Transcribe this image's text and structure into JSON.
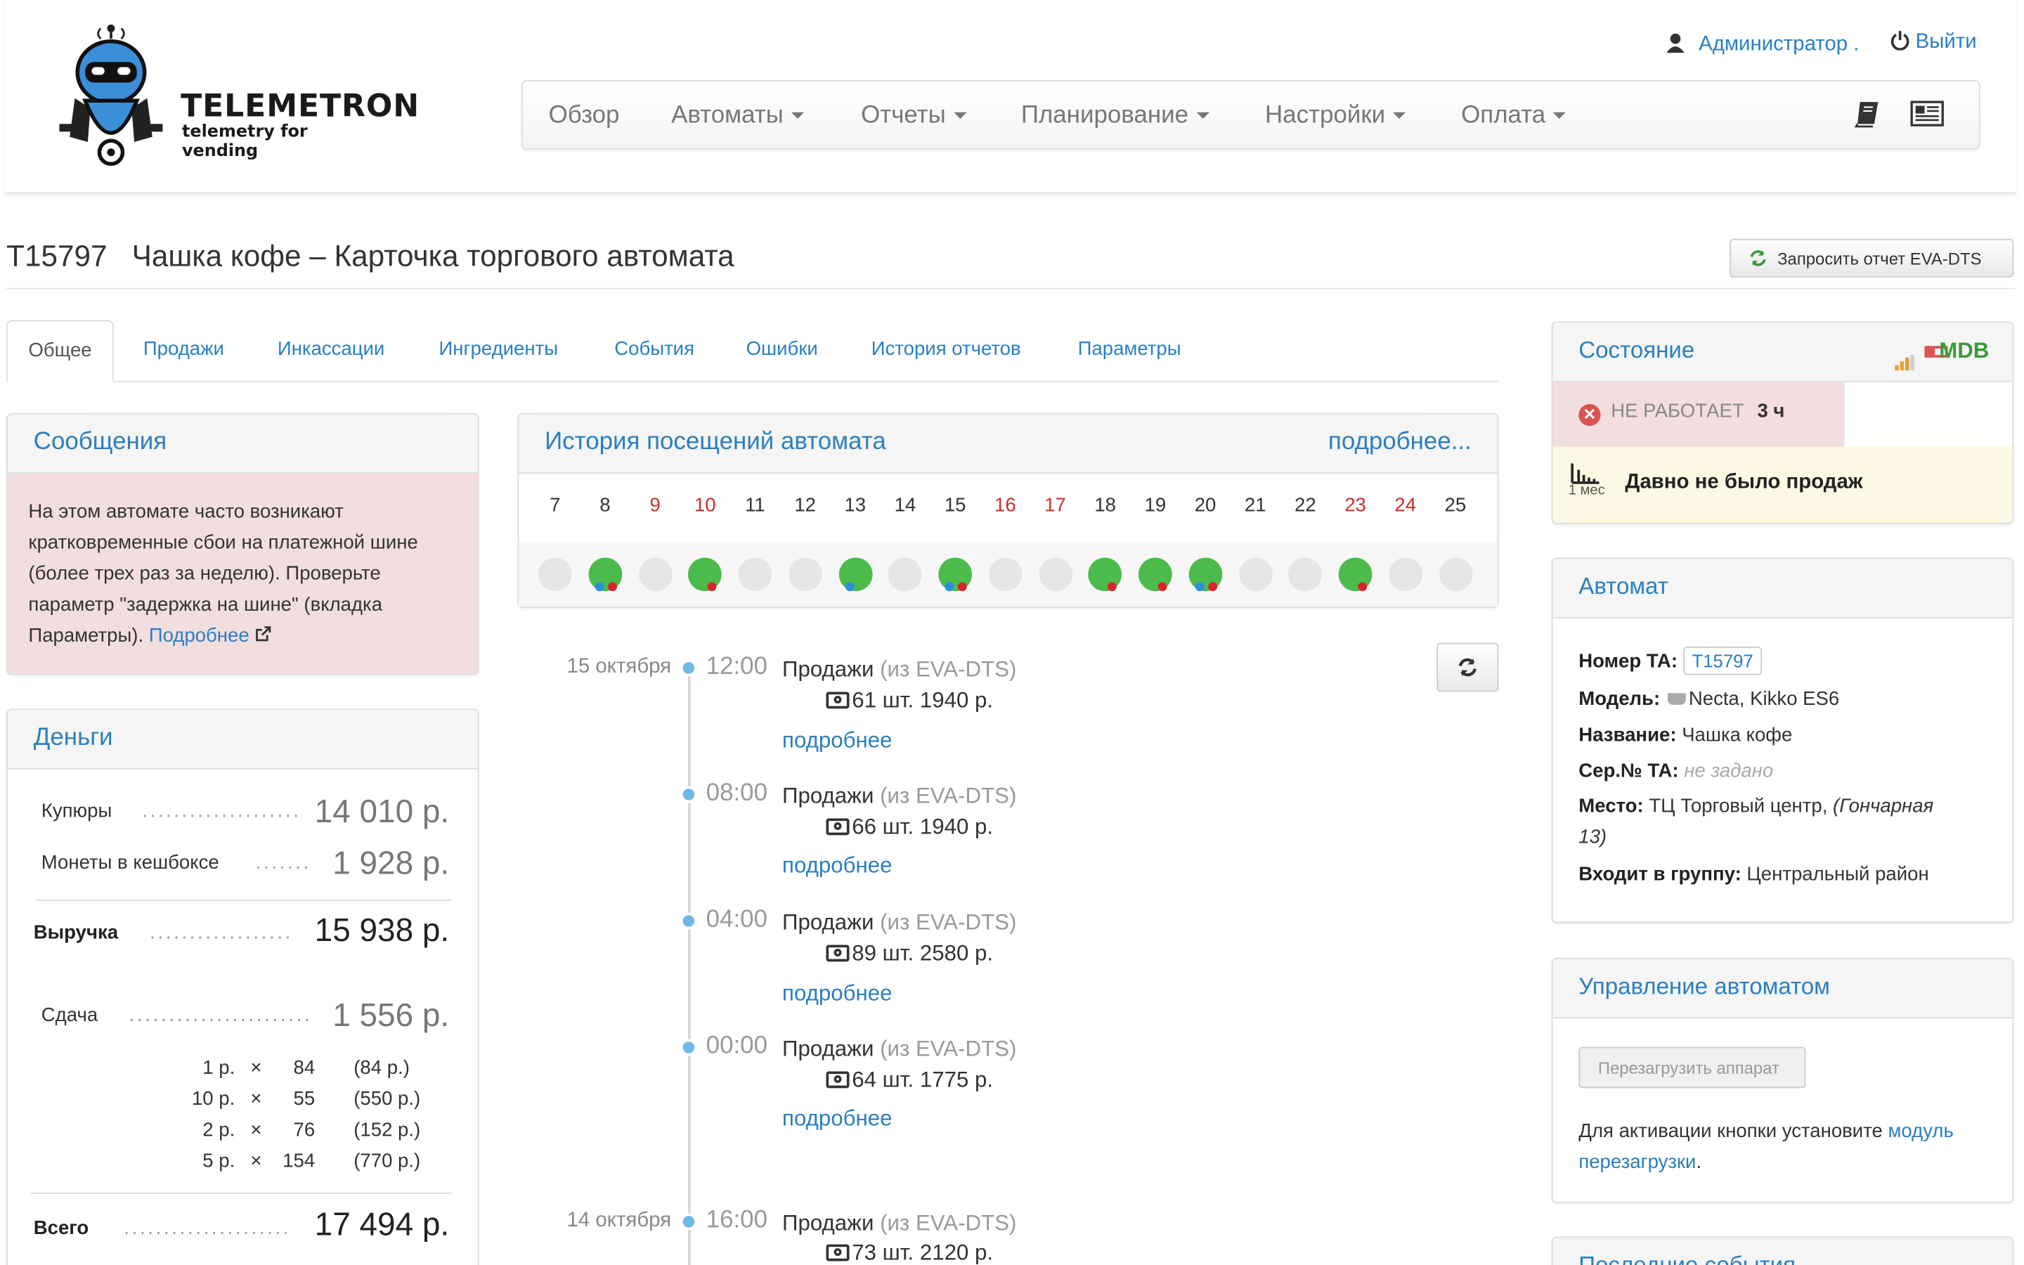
{
  "header": {
    "logo_title": "TELEMETRON",
    "logo_subtitle": "telemetry for vending",
    "user_label": "Администратор .",
    "logout_label": "Выйти",
    "nav": [
      {
        "label": "Обзор",
        "has_caret": false
      },
      {
        "label": "Автоматы",
        "has_caret": true
      },
      {
        "label": "Отчеты",
        "has_caret": true
      },
      {
        "label": "Планирование",
        "has_caret": true
      },
      {
        "label": "Настройки",
        "has_caret": true
      },
      {
        "label": "Оплата",
        "has_caret": true
      }
    ],
    "icons": [
      "book-icon",
      "newspaper-icon"
    ]
  },
  "page": {
    "title": "Т15797   Чашка кофе – Карточка торгового автомата",
    "eva_button": "Запросить отчет EVA-DTS"
  },
  "tabs": [
    "Общее",
    "Продажи",
    "Инкассации",
    "Ингредиенты",
    "События",
    "Ошибки",
    "История отчетов",
    "Параметры"
  ],
  "messages": {
    "title": "Сообщения",
    "text": "На этом автомате часто возникают кратковременные сбои на платежной шине (более трех раз за неделю). Проверьте параметр \"задержка на шине\" (вкладка Параметры).",
    "link": "Подробнее"
  },
  "money": {
    "title": "Деньги",
    "bills_label": "Купюры",
    "bills_value": "14 010 р.",
    "coins_label": "Монеты в кешбоксе",
    "coins_value": "1 928 р.",
    "revenue_label": "Выручка",
    "revenue_value": "15 938 р.",
    "change_label": "Сдача",
    "change_value": "1 556 р.",
    "coins": [
      {
        "nominal": "1 р.",
        "x": "×",
        "count": "84",
        "sum": "(84 р.)"
      },
      {
        "nominal": "10 р.",
        "x": "×",
        "count": "55",
        "sum": "(550 р.)"
      },
      {
        "nominal": "2 р.",
        "x": "×",
        "count": "76",
        "sum": "(152 р.)"
      },
      {
        "nominal": "5 р.",
        "x": "×",
        "count": "154",
        "sum": "(770 р.)"
      }
    ],
    "total_label": "Всего",
    "total_value": "17 494 р."
  },
  "history": {
    "title": "История посещений автомата",
    "more": "подробнее...",
    "days": [
      {
        "d": "7",
        "red": false,
        "visit": false,
        "blue": false,
        "redsub": false
      },
      {
        "d": "8",
        "red": false,
        "visit": true,
        "blue": true,
        "redsub": true
      },
      {
        "d": "9",
        "red": true,
        "visit": false,
        "blue": false,
        "redsub": false
      },
      {
        "d": "10",
        "red": true,
        "visit": true,
        "blue": false,
        "redsub": true
      },
      {
        "d": "11",
        "red": false,
        "visit": false,
        "blue": false,
        "redsub": false
      },
      {
        "d": "12",
        "red": false,
        "visit": false,
        "blue": false,
        "redsub": false
      },
      {
        "d": "13",
        "red": false,
        "visit": true,
        "blue": true,
        "redsub": false
      },
      {
        "d": "14",
        "red": false,
        "visit": false,
        "blue": false,
        "redsub": false
      },
      {
        "d": "15",
        "red": false,
        "visit": true,
        "blue": true,
        "redsub": true
      },
      {
        "d": "16",
        "red": true,
        "visit": false,
        "blue": false,
        "redsub": false
      },
      {
        "d": "17",
        "red": true,
        "visit": false,
        "blue": false,
        "redsub": false
      },
      {
        "d": "18",
        "red": false,
        "visit": true,
        "blue": false,
        "redsub": true
      },
      {
        "d": "19",
        "red": false,
        "visit": true,
        "blue": false,
        "redsub": true
      },
      {
        "d": "20",
        "red": false,
        "visit": true,
        "blue": true,
        "redsub": true
      },
      {
        "d": "21",
        "red": false,
        "visit": false,
        "blue": false,
        "redsub": false
      },
      {
        "d": "22",
        "red": false,
        "visit": false,
        "blue": false,
        "redsub": false
      },
      {
        "d": "23",
        "red": true,
        "visit": true,
        "blue": false,
        "redsub": true
      },
      {
        "d": "24",
        "red": true,
        "visit": false,
        "blue": false,
        "redsub": false
      },
      {
        "d": "25",
        "red": false,
        "visit": false,
        "blue": false,
        "redsub": false
      }
    ]
  },
  "timeline": [
    {
      "date": "15 октября",
      "time": "12:00",
      "title": "Продажи",
      "source": "(из EVA-DTS)",
      "summary": "61 шт. 1940 р.",
      "more": "подробнее"
    },
    {
      "date": "",
      "time": "08:00",
      "title": "Продажи",
      "source": "(из EVA-DTS)",
      "summary": "66 шт. 1940 р.",
      "more": "подробнее"
    },
    {
      "date": "",
      "time": "04:00",
      "title": "Продажи",
      "source": "(из EVA-DTS)",
      "summary": "89 шт. 2580 р.",
      "more": "подробнее"
    },
    {
      "date": "",
      "time": "00:00",
      "title": "Продажи",
      "source": "(из EVA-DTS)",
      "summary": "64 шт. 1775 р.",
      "more": "подробнее"
    },
    {
      "date": "14 октября",
      "time": "16:00",
      "title": "Продажи",
      "source": "(из EVA-DTS)",
      "summary": "73 шт. 2120 р.",
      "more": ""
    }
  ],
  "state": {
    "title": "Состояние",
    "mdb": "MDB",
    "status": "НЕ РАБОТАЕТ",
    "duration": "3 ч",
    "warn_period": "1 мес",
    "warn_text": "Давно не было продаж"
  },
  "machine": {
    "title": "Автомат",
    "number_label": "Номер ТА:",
    "number_value": "T15797",
    "model_label": "Модель:",
    "model_value": "Necta, Kikko ES6",
    "name_label": "Название:",
    "name_value": "Чашка кофе",
    "serial_label": "Сер.№ ТА:",
    "serial_value": "не задано",
    "place_label": "Место:",
    "place_value": "ТЦ Торговый центр,",
    "place_addr1": "(Гончарная",
    "place_addr2": "13)",
    "group_label": "Входит в группу:",
    "group_value": "Центральный район"
  },
  "control": {
    "title": "Управление автоматом",
    "reboot_button": "Перезагрузить аппарат",
    "hint_text1": "Для активации кнопки установите",
    "hint_link1": "модуль",
    "hint_link2": "перезагрузки",
    "hint_end": "."
  },
  "last_events": {
    "title": "Последние события"
  },
  "colors": {
    "accent": "#2a7fc1",
    "green": "#4cbb4c",
    "red": "#c9302c",
    "danger_bg": "#f2dede",
    "warn_bg": "#fcf8e3"
  }
}
